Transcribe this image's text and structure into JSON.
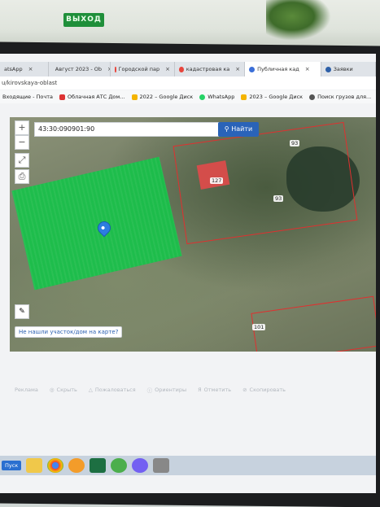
{
  "room": {
    "exit_sign": "ВЫХОД"
  },
  "browser": {
    "tabs": [
      {
        "label": "atsApp",
        "color": "#25d366"
      },
      {
        "label": "Август 2023 - Ob",
        "color": "#188038"
      },
      {
        "label": "Городской пар",
        "color": "#e8453c"
      },
      {
        "label": "кадастровая ка",
        "color": "#e8453c"
      },
      {
        "label": "Публичная кад",
        "color": "#3b6fd8"
      },
      {
        "label": "Заявки",
        "color": "#2d5fa8"
      }
    ],
    "url": "u/kirovskaya-oblast",
    "bookmarks": [
      {
        "label": "Входящие - Почта"
      },
      {
        "label": "Облачная АТС Дом..."
      },
      {
        "label": "2022 – Google Диск"
      },
      {
        "label": "WhatsApp"
      },
      {
        "label": "2023 – Google Диск"
      },
      {
        "label": "Поиск грузов для..."
      }
    ]
  },
  "map": {
    "search_value": "43:30:090901:90",
    "search_button": "Найти",
    "zoom_in": "+",
    "zoom_out": "−",
    "expand": "⤢",
    "print": "⎙",
    "draw": "✎",
    "not_found_link": "Не нашли участок/дом на карте?",
    "labels": {
      "a": "93",
      "b": "93",
      "c": "101",
      "d": "127"
    }
  },
  "actions": [
    {
      "label": "Реклама"
    },
    {
      "label": "Скрыть"
    },
    {
      "label": "Пожаловаться"
    },
    {
      "label": "Ориентиры"
    },
    {
      "label": "Отметить"
    },
    {
      "label": "Скопировать"
    }
  ],
  "taskbar": {
    "label": "Пуск"
  },
  "colors": {
    "green_parcel": "#18c24a",
    "parcel_border": "#e0302f",
    "accent": "#2a63b8"
  }
}
